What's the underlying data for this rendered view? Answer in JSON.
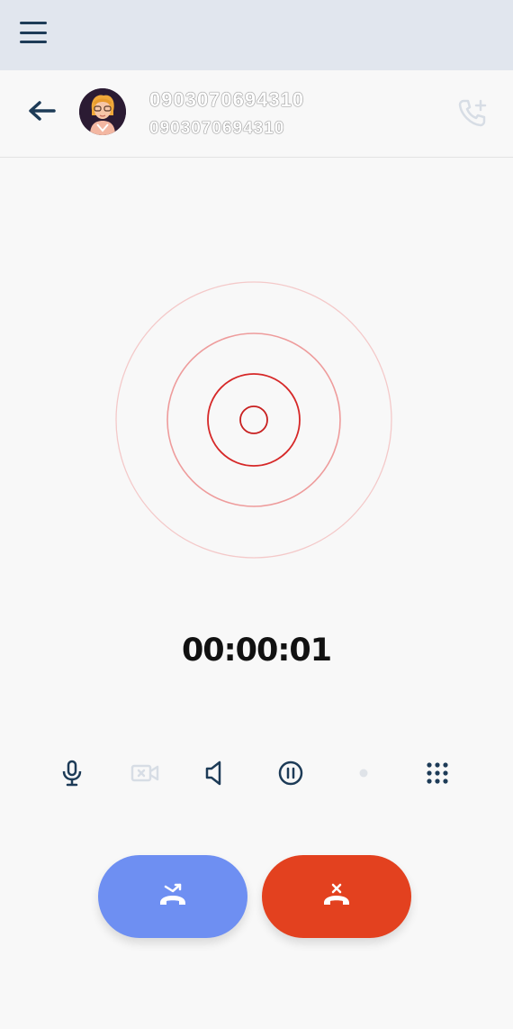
{
  "header": {
    "menu_icon": "hamburger-menu-icon"
  },
  "call": {
    "contact_name": "0903070694310",
    "contact_number": "0903070694310",
    "back_icon": "arrow-left-icon",
    "add_call_icon": "phone-plus-icon",
    "timer": "00:00:01"
  },
  "controls": [
    "microphone-icon",
    "video-off-icon",
    "speaker-icon",
    "pause-icon",
    "dot-icon",
    "dialpad-icon"
  ],
  "actions": {
    "transfer_icon": "call-transfer-icon",
    "hangup_icon": "end-call-icon"
  },
  "colors": {
    "header_bg": "#e1e6ee",
    "accent_dark": "#1d3b57",
    "transfer": "#6e8ff2",
    "hangup": "#e3411f",
    "rings": "#d62828"
  }
}
